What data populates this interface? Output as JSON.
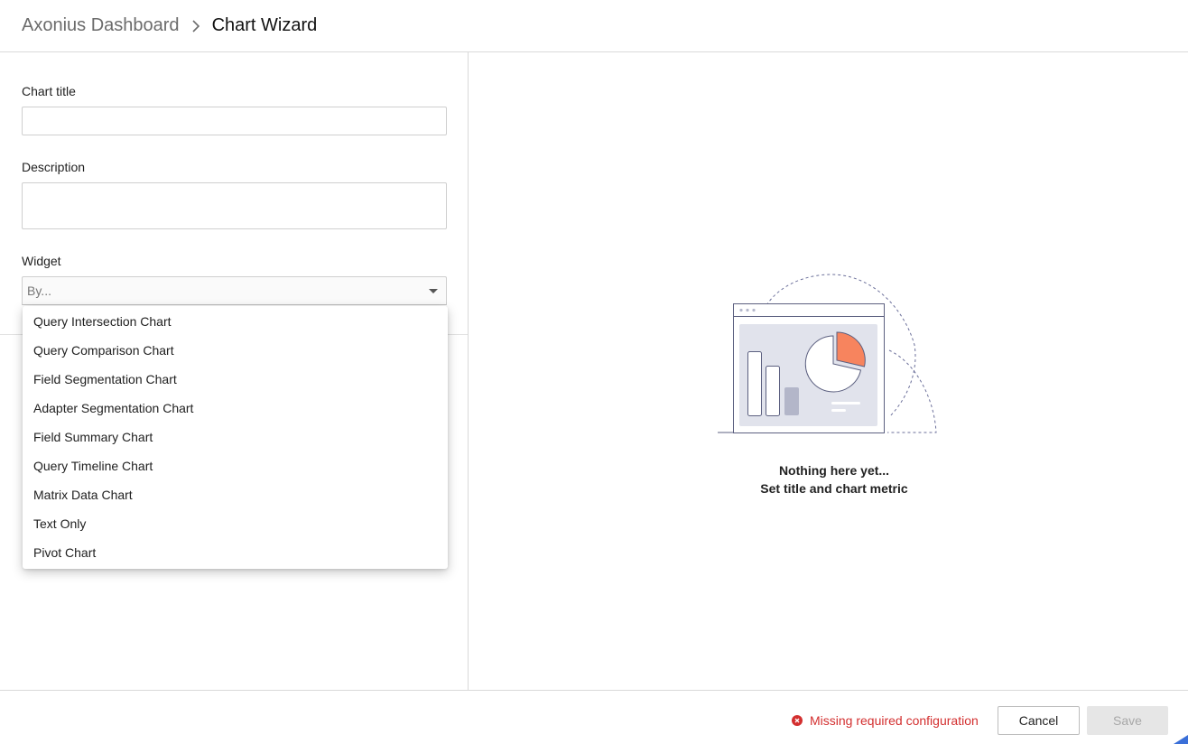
{
  "header": {
    "breadcrumb_root": "Axonius Dashboard",
    "breadcrumb_current": "Chart Wizard"
  },
  "form": {
    "title_label": "Chart title",
    "title_value": "",
    "description_label": "Description",
    "description_value": "",
    "widget_label": "Widget",
    "widget_placeholder": "By..."
  },
  "widget_menu": {
    "items": [
      "Query Intersection Chart",
      "Query Comparison Chart",
      "Field Segmentation Chart",
      "Adapter Segmentation Chart",
      "Field Summary Chart",
      "Query Timeline Chart",
      "Matrix Data Chart",
      "Text Only",
      "Pivot Chart"
    ]
  },
  "preview": {
    "empty_line1": "Nothing here yet...",
    "empty_line2": "Set title and chart metric"
  },
  "footer": {
    "error_text": "Missing required configuration",
    "cancel_label": "Cancel",
    "save_label": "Save"
  },
  "colors": {
    "accent_orange": "#f7845e",
    "error_red": "#d32f2f",
    "illustration_stroke": "#5c6080"
  }
}
